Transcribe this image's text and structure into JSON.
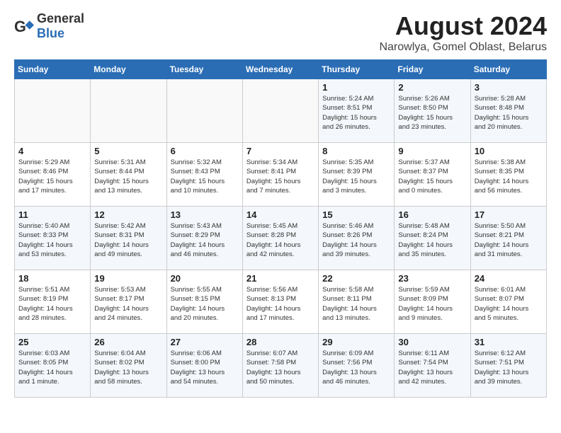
{
  "header": {
    "logo_general": "General",
    "logo_blue": "Blue",
    "title": "August 2024",
    "subtitle": "Narowlya, Gomel Oblast, Belarus"
  },
  "weekdays": [
    "Sunday",
    "Monday",
    "Tuesday",
    "Wednesday",
    "Thursday",
    "Friday",
    "Saturday"
  ],
  "weeks": [
    [
      {
        "day": "",
        "info": ""
      },
      {
        "day": "",
        "info": ""
      },
      {
        "day": "",
        "info": ""
      },
      {
        "day": "",
        "info": ""
      },
      {
        "day": "1",
        "info": "Sunrise: 5:24 AM\nSunset: 8:51 PM\nDaylight: 15 hours\nand 26 minutes."
      },
      {
        "day": "2",
        "info": "Sunrise: 5:26 AM\nSunset: 8:50 PM\nDaylight: 15 hours\nand 23 minutes."
      },
      {
        "day": "3",
        "info": "Sunrise: 5:28 AM\nSunset: 8:48 PM\nDaylight: 15 hours\nand 20 minutes."
      }
    ],
    [
      {
        "day": "4",
        "info": "Sunrise: 5:29 AM\nSunset: 8:46 PM\nDaylight: 15 hours\nand 17 minutes."
      },
      {
        "day": "5",
        "info": "Sunrise: 5:31 AM\nSunset: 8:44 PM\nDaylight: 15 hours\nand 13 minutes."
      },
      {
        "day": "6",
        "info": "Sunrise: 5:32 AM\nSunset: 8:43 PM\nDaylight: 15 hours\nand 10 minutes."
      },
      {
        "day": "7",
        "info": "Sunrise: 5:34 AM\nSunset: 8:41 PM\nDaylight: 15 hours\nand 7 minutes."
      },
      {
        "day": "8",
        "info": "Sunrise: 5:35 AM\nSunset: 8:39 PM\nDaylight: 15 hours\nand 3 minutes."
      },
      {
        "day": "9",
        "info": "Sunrise: 5:37 AM\nSunset: 8:37 PM\nDaylight: 15 hours\nand 0 minutes."
      },
      {
        "day": "10",
        "info": "Sunrise: 5:38 AM\nSunset: 8:35 PM\nDaylight: 14 hours\nand 56 minutes."
      }
    ],
    [
      {
        "day": "11",
        "info": "Sunrise: 5:40 AM\nSunset: 8:33 PM\nDaylight: 14 hours\nand 53 minutes."
      },
      {
        "day": "12",
        "info": "Sunrise: 5:42 AM\nSunset: 8:31 PM\nDaylight: 14 hours\nand 49 minutes."
      },
      {
        "day": "13",
        "info": "Sunrise: 5:43 AM\nSunset: 8:29 PM\nDaylight: 14 hours\nand 46 minutes."
      },
      {
        "day": "14",
        "info": "Sunrise: 5:45 AM\nSunset: 8:28 PM\nDaylight: 14 hours\nand 42 minutes."
      },
      {
        "day": "15",
        "info": "Sunrise: 5:46 AM\nSunset: 8:26 PM\nDaylight: 14 hours\nand 39 minutes."
      },
      {
        "day": "16",
        "info": "Sunrise: 5:48 AM\nSunset: 8:24 PM\nDaylight: 14 hours\nand 35 minutes."
      },
      {
        "day": "17",
        "info": "Sunrise: 5:50 AM\nSunset: 8:21 PM\nDaylight: 14 hours\nand 31 minutes."
      }
    ],
    [
      {
        "day": "18",
        "info": "Sunrise: 5:51 AM\nSunset: 8:19 PM\nDaylight: 14 hours\nand 28 minutes."
      },
      {
        "day": "19",
        "info": "Sunrise: 5:53 AM\nSunset: 8:17 PM\nDaylight: 14 hours\nand 24 minutes."
      },
      {
        "day": "20",
        "info": "Sunrise: 5:55 AM\nSunset: 8:15 PM\nDaylight: 14 hours\nand 20 minutes."
      },
      {
        "day": "21",
        "info": "Sunrise: 5:56 AM\nSunset: 8:13 PM\nDaylight: 14 hours\nand 17 minutes."
      },
      {
        "day": "22",
        "info": "Sunrise: 5:58 AM\nSunset: 8:11 PM\nDaylight: 14 hours\nand 13 minutes."
      },
      {
        "day": "23",
        "info": "Sunrise: 5:59 AM\nSunset: 8:09 PM\nDaylight: 14 hours\nand 9 minutes."
      },
      {
        "day": "24",
        "info": "Sunrise: 6:01 AM\nSunset: 8:07 PM\nDaylight: 14 hours\nand 5 minutes."
      }
    ],
    [
      {
        "day": "25",
        "info": "Sunrise: 6:03 AM\nSunset: 8:05 PM\nDaylight: 14 hours\nand 1 minute."
      },
      {
        "day": "26",
        "info": "Sunrise: 6:04 AM\nSunset: 8:02 PM\nDaylight: 13 hours\nand 58 minutes."
      },
      {
        "day": "27",
        "info": "Sunrise: 6:06 AM\nSunset: 8:00 PM\nDaylight: 13 hours\nand 54 minutes."
      },
      {
        "day": "28",
        "info": "Sunrise: 6:07 AM\nSunset: 7:58 PM\nDaylight: 13 hours\nand 50 minutes."
      },
      {
        "day": "29",
        "info": "Sunrise: 6:09 AM\nSunset: 7:56 PM\nDaylight: 13 hours\nand 46 minutes."
      },
      {
        "day": "30",
        "info": "Sunrise: 6:11 AM\nSunset: 7:54 PM\nDaylight: 13 hours\nand 42 minutes."
      },
      {
        "day": "31",
        "info": "Sunrise: 6:12 AM\nSunset: 7:51 PM\nDaylight: 13 hours\nand 39 minutes."
      }
    ]
  ]
}
